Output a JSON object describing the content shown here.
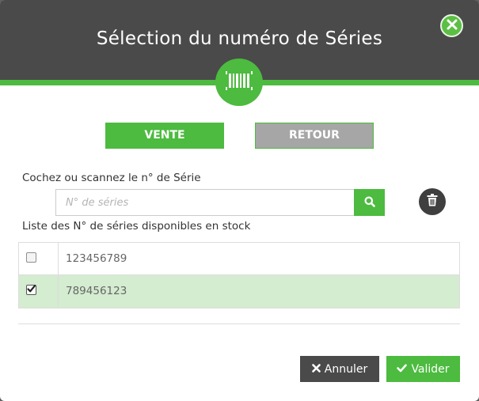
{
  "dialog": {
    "title": "Sélection du numéro de Séries",
    "close_icon": "close-icon",
    "badge_icon": "barcode-icon"
  },
  "mode": {
    "vente_label": "VENTE",
    "retour_label": "RETOUR",
    "active": "VENTE"
  },
  "search": {
    "label": "Cochez ou scannez le n° de Série",
    "placeholder": "N° de séries",
    "value": "",
    "search_icon": "search-icon",
    "trash_icon": "trash-icon"
  },
  "list": {
    "label": "Liste des N° de séries disponibles en stock",
    "rows": [
      {
        "serial": "123456789",
        "checked": false
      },
      {
        "serial": "789456123",
        "checked": true
      }
    ]
  },
  "footer": {
    "cancel_label": "Annuler",
    "confirm_label": "Valider"
  },
  "colors": {
    "accent": "#4cbb3f",
    "header": "#4a4a4a",
    "selected_row": "#d4ecd0"
  }
}
